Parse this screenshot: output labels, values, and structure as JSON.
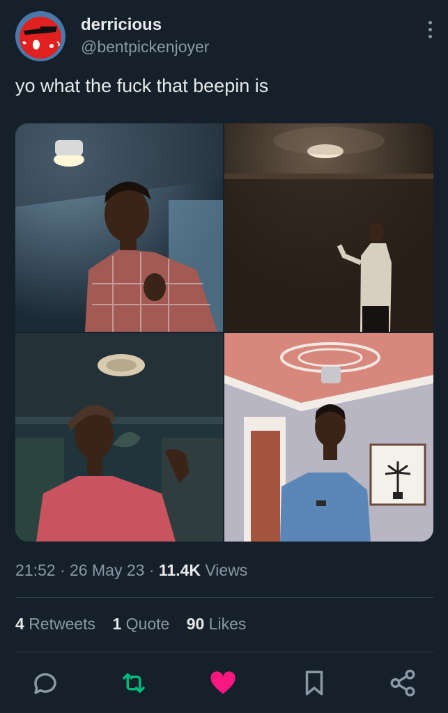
{
  "tweet": {
    "display_name": "derricious",
    "handle": "@bentpickenjoyer",
    "text": "yo what the fuck that beepin is",
    "time": "21:52",
    "sep1": "·",
    "date": "26 May 23",
    "sep2": "·",
    "views_count": "11.4K",
    "views_label": "Views"
  },
  "stats": {
    "retweets_count": "4",
    "retweets_label": "Retweets",
    "quotes_count": "1",
    "quotes_label": "Quote",
    "likes_count": "90",
    "likes_label": "Likes"
  },
  "colors": {
    "background": "#15202b",
    "retweet_accent": "#00ba7c",
    "like_accent": "#f91880",
    "muted_text": "#8b98a5",
    "primary_text": "#e7e9ea"
  },
  "icons": [
    "more-options-icon",
    "reply-icon",
    "retweet-icon",
    "like-icon",
    "bookmark-icon",
    "share-icon"
  ]
}
